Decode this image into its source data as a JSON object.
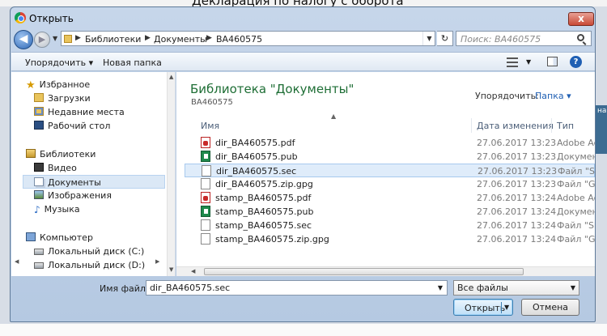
{
  "background": {
    "title": "Декларация по налогу с оборота",
    "right_fragment": "на"
  },
  "window": {
    "title": "Открыть",
    "close_label": "x"
  },
  "address": {
    "items": [
      "Библиотеки",
      "Документы",
      "BA460575"
    ]
  },
  "search": {
    "placeholder": "Поиск: BA460575"
  },
  "toolbar": {
    "organize_label": "Упорядочить ▾",
    "new_folder_label": "Новая папка",
    "help_label": "?"
  },
  "navigation": {
    "favorites_label": "Избранное",
    "downloads": "Загрузки",
    "recent": "Недавние места",
    "desktop": "Рабочий стол",
    "libraries_label": "Библиотеки",
    "video": "Видео",
    "documents": "Документы",
    "images": "Изображения",
    "music": "Музыка",
    "computer_label": "Компьютер",
    "disk_c": "Локальный диск (C:)",
    "disk_d": "Локальный диск (D:)"
  },
  "library": {
    "title": "Библиотека \"Документы\"",
    "subtitle": "BA460575",
    "arrange_label": "Упорядочить:",
    "arrange_value": "Папка ▾"
  },
  "columns": {
    "name": "Имя",
    "date": "Дата изменения",
    "type": "Тип"
  },
  "files": [
    {
      "name": "dir_BA460575.pdf",
      "date": "27.06.2017 13:23",
      "type": "Adobe Acrob",
      "icon": "pdf-icon"
    },
    {
      "name": "dir_BA460575.pub",
      "date": "27.06.2017 13:23",
      "type": "Документ M",
      "icon": "publisher-icon"
    },
    {
      "name": "dir_BA460575.sec",
      "date": "27.06.2017 13:23",
      "type": "Файл \"SEC\"",
      "icon": "file-icon"
    },
    {
      "name": "dir_BA460575.zip.gpg",
      "date": "27.06.2017 13:23",
      "type": "Файл \"GPG\"",
      "icon": "file-icon"
    },
    {
      "name": "stamp_BA460575.pdf",
      "date": "27.06.2017 13:24",
      "type": "Adobe Acrob",
      "icon": "pdf-icon"
    },
    {
      "name": "stamp_BA460575.pub",
      "date": "27.06.2017 13:24",
      "type": "Документ M",
      "icon": "publisher-icon"
    },
    {
      "name": "stamp_BA460575.sec",
      "date": "27.06.2017 13:24",
      "type": "Файл \"SEC\"",
      "icon": "file-icon"
    },
    {
      "name": "stamp_BA460575.zip.gpg",
      "date": "27.06.2017 13:24",
      "type": "Файл \"GPG\"",
      "icon": "file-icon"
    }
  ],
  "footer": {
    "filename_label": "Имя файла:",
    "filename_value": "dir_BA460575.sec",
    "filter_value": "Все файлы",
    "open_label": "Открыть",
    "cancel_label": "Отмена"
  }
}
